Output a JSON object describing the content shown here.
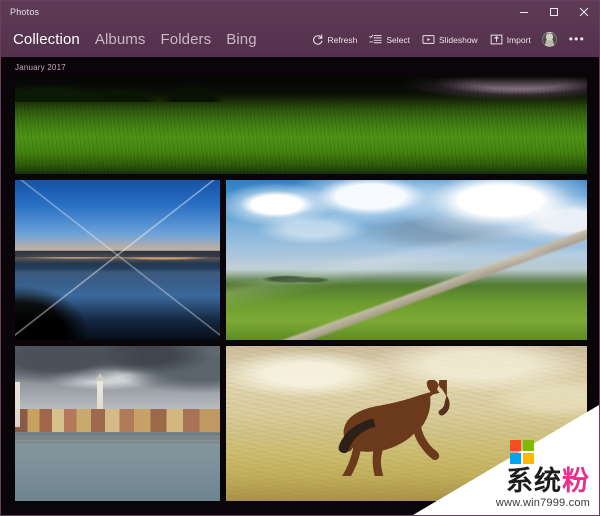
{
  "window": {
    "title": "Photos",
    "controls": [
      {
        "name": "minimize",
        "glyph": "minimize-icon"
      },
      {
        "name": "maximize",
        "glyph": "maximize-icon"
      },
      {
        "name": "close",
        "glyph": "close-icon"
      }
    ],
    "accent_color": "#5b3753",
    "titlebar_color": "#5d3b56"
  },
  "nav": {
    "tabs": [
      {
        "label": "Collection",
        "active": true
      },
      {
        "label": "Albums",
        "active": false
      },
      {
        "label": "Folders",
        "active": false
      },
      {
        "label": "Bing",
        "active": false
      }
    ]
  },
  "toolbar": {
    "refresh_label": "Refresh",
    "select_label": "Select",
    "slideshow_label": "Slideshow",
    "import_label": "Import",
    "more_label": "•••",
    "icons": {
      "refresh": "refresh-icon",
      "select": "checklist-icon",
      "slideshow": "play-rectangle-icon",
      "import": "import-box-icon",
      "account": "account-avatar-icon",
      "more": "more-ellipsis-icon"
    }
  },
  "collection": {
    "date_group_label": "January 2017",
    "photos": [
      {
        "id": "photo-grass-field",
        "alt": "Panoramic green grass field with dark tree line and bright horizon",
        "row": 1,
        "span": "full"
      },
      {
        "id": "photo-bay-bridge",
        "alt": "Suspension bridge at dusk reflected in calm water",
        "row": 2,
        "span": "left"
      },
      {
        "id": "photo-cloudy-field",
        "alt": "Dramatic clouds and sunbeams over a green field with dirt road",
        "row": 2,
        "span": "right"
      },
      {
        "id": "photo-coastal-town",
        "alt": "Colorful coastal town with bell tower under storm clouds",
        "row": 3,
        "span": "left"
      },
      {
        "id": "photo-running-horse",
        "alt": "Brown horse galloping across a sepia grunge field",
        "row": 3,
        "span": "right"
      }
    ]
  },
  "watermark": {
    "brand_cn_part1": "系统",
    "brand_cn_part2": "粉",
    "url": "www.win7999.com",
    "logo_colors": [
      "#f25022",
      "#7fba00",
      "#00a4ef",
      "#ffb900"
    ],
    "accent_pink": "#e8318a"
  }
}
